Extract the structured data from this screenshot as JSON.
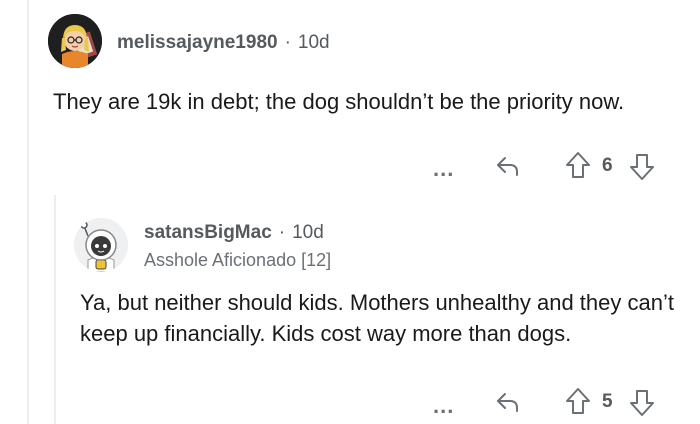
{
  "comments": [
    {
      "username": "melissajayne1980",
      "separator": "·",
      "age": "10d",
      "text": "They are 19k in debt; the dog shouldn’t be the priority now.",
      "more_label": "...",
      "score": "6"
    },
    {
      "username": "satansBigMac",
      "separator": "·",
      "age": "10d",
      "flair": "Asshole Aficionado [12]",
      "text": "Ya, but neither should kids. Mothers unhealthy and they can’t keep up financially. Kids cost way more than dogs.",
      "more_label": "...",
      "score": "5"
    }
  ],
  "colors": {
    "text": "#1a1a1b",
    "meta": "#555a5e",
    "icon": "#6b7075",
    "thread_line": "#ededed"
  }
}
